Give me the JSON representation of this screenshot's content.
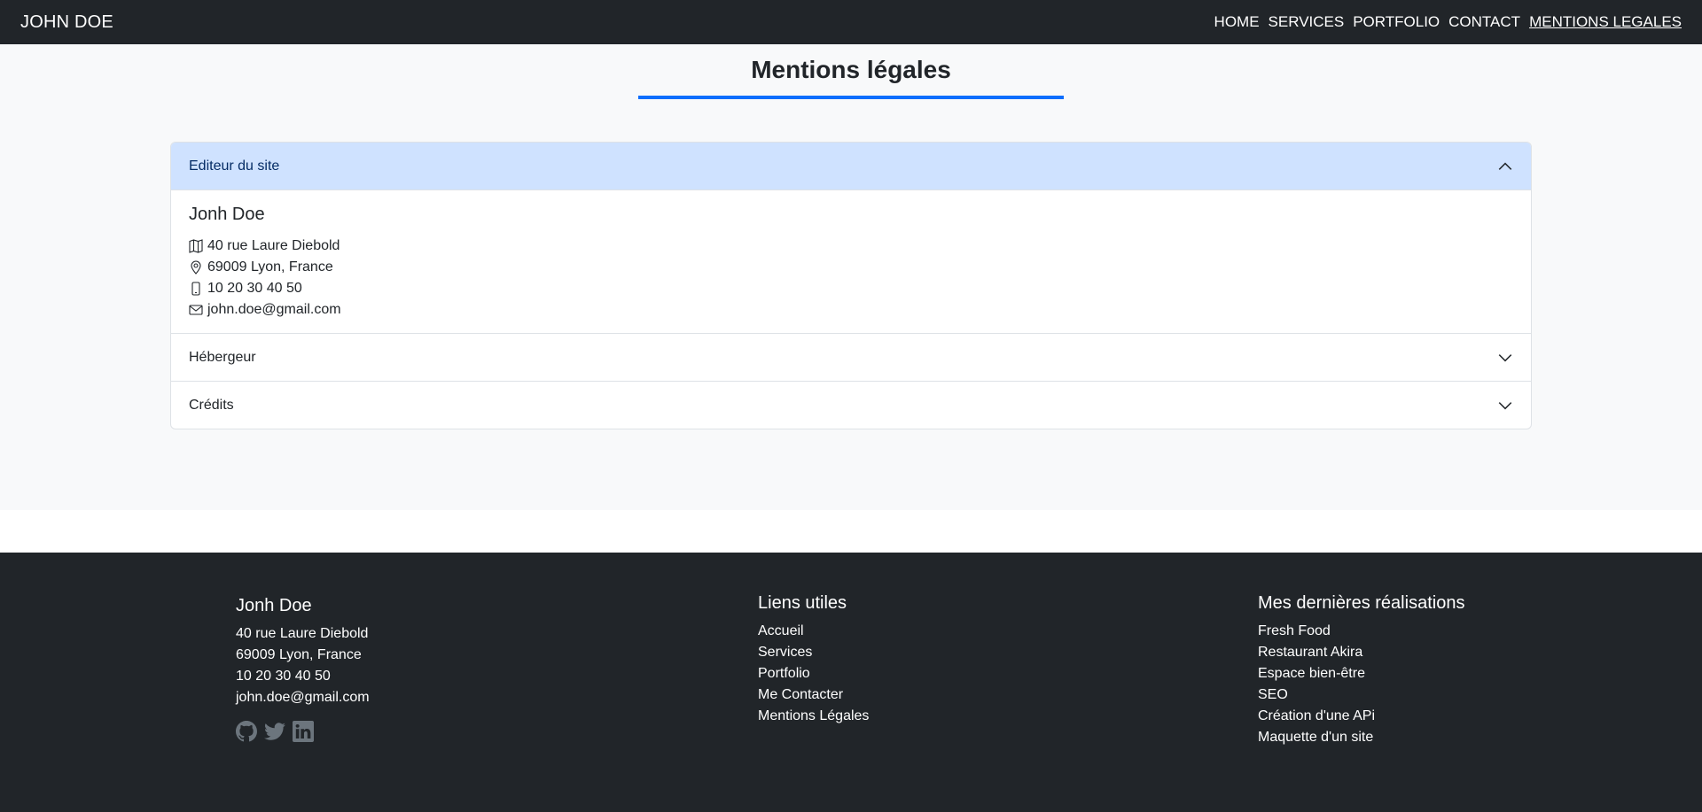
{
  "navbar": {
    "brand": "JOHN DOE",
    "links": [
      "HOME",
      "SERVICES",
      "PORTFOLIO",
      "CONTACT",
      "MENTIONS LEGALES"
    ]
  },
  "page": {
    "title": "Mentions légales"
  },
  "accordion": {
    "items": [
      {
        "title": "Editeur du site",
        "open": true,
        "name": "Jonh Doe",
        "address": "40 rue Laure Diebold",
        "city": "69009 Lyon, France",
        "phone": "10 20 30 40 50",
        "email": "john.doe@gmail.com"
      },
      {
        "title": "Hébergeur",
        "open": false
      },
      {
        "title": "Crédits",
        "open": false
      }
    ]
  },
  "footer": {
    "contact": {
      "name": "Jonh Doe",
      "address": "40 rue Laure Diebold",
      "city": "69009 Lyon, France",
      "phone": "10 20 30 40 50",
      "email": "john.doe@gmail.com",
      "social_icons": [
        "github-icon",
        "twitter-icon",
        "linkedin-icon"
      ]
    },
    "links": {
      "title": "Liens utiles",
      "items": [
        "Accueil",
        "Services",
        "Portfolio",
        "Me Contacter",
        "Mentions Légales"
      ]
    },
    "projects": {
      "title": "Mes dernières réalisations",
      "items": [
        "Fresh Food",
        "Restaurant Akira",
        "Espace bien-être",
        "SEO",
        "Création d'une APi",
        "Maquette d'un site"
      ]
    }
  },
  "colors": {
    "navbar_bg": "#212529",
    "accent": "#0d6efd",
    "accordion_active_bg": "#cfe2ff",
    "social_icon": "#6c757d"
  }
}
